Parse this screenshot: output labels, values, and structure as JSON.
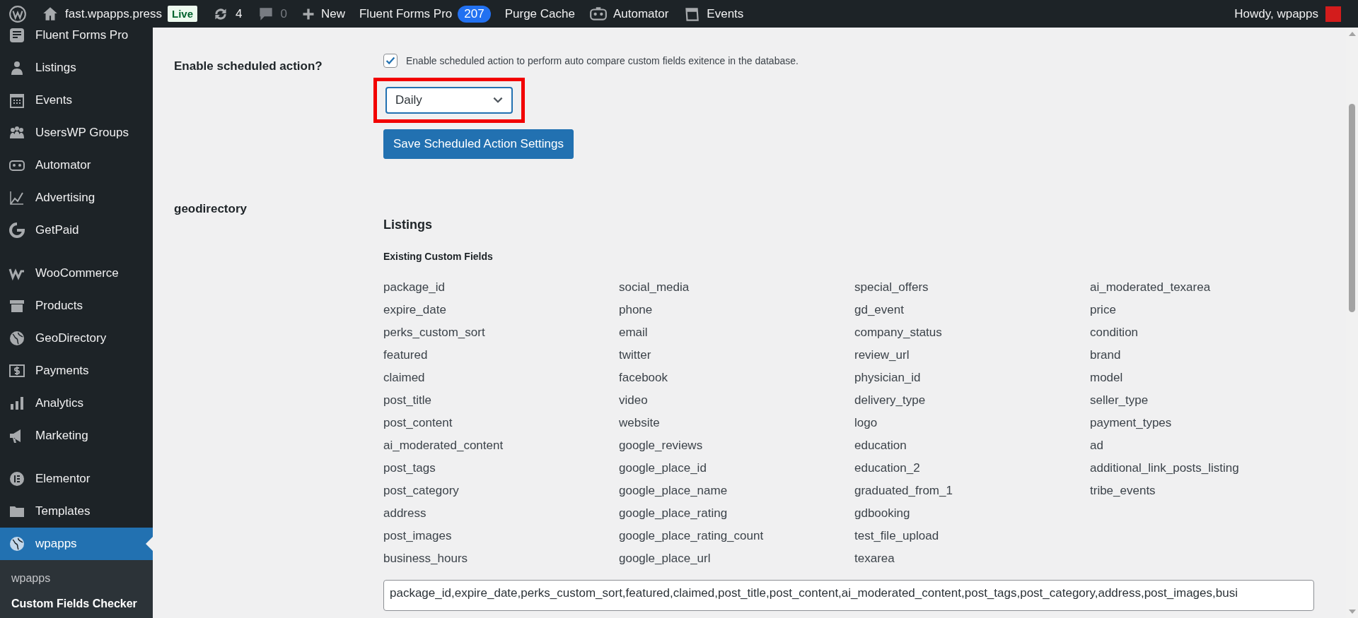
{
  "admin_bar": {
    "site_name": "fast.wpapps.press",
    "live_badge": "Live",
    "updates_count": "4",
    "comments_count": "0",
    "new_label": "New",
    "fluent_forms": {
      "label": "Fluent Forms Pro",
      "count": "207"
    },
    "purge_cache": "Purge Cache",
    "automator": "Automator",
    "events": "Events",
    "greeting": "Howdy, wpapps"
  },
  "sidebar": {
    "groups": [
      [
        {
          "label": "Fluent Forms Pro",
          "selected": false
        },
        {
          "label": "Listings",
          "selected": false
        },
        {
          "label": "Events",
          "selected": false
        },
        {
          "label": "UsersWP Groups",
          "selected": false
        },
        {
          "label": "Automator",
          "selected": false
        },
        {
          "label": "Advertising",
          "selected": false
        },
        {
          "label": "GetPaid",
          "selected": false
        }
      ],
      [
        {
          "label": "WooCommerce",
          "selected": false
        },
        {
          "label": "Products",
          "selected": false
        },
        {
          "label": "GeoDirectory",
          "selected": false
        },
        {
          "label": "Payments",
          "selected": false
        },
        {
          "label": "Analytics",
          "selected": false
        },
        {
          "label": "Marketing",
          "selected": false
        }
      ],
      [
        {
          "label": "Elementor",
          "selected": false
        },
        {
          "label": "Templates",
          "selected": false
        },
        {
          "label": "wpapps",
          "selected": true
        }
      ]
    ],
    "submenu": [
      {
        "label": "wpapps",
        "selected": false
      },
      {
        "label": "Custom Fields Checker",
        "selected": true
      }
    ]
  },
  "scheduled": {
    "label": "Enable scheduled action?",
    "checkbox": {
      "checked": true,
      "label": "Enable scheduled action to perform auto compare custom fields exitence in the database."
    },
    "frequency": {
      "value": "Daily",
      "highlighted": true
    },
    "save_button": "Save Scheduled Action Settings"
  },
  "section": {
    "name": "geodirectory",
    "post_type": "Listings",
    "subheading": "Existing Custom Fields",
    "columns": [
      [
        "package_id",
        "expire_date",
        "perks_custom_sort",
        "featured",
        "claimed",
        "post_title",
        "post_content",
        "ai_moderated_content",
        "post_tags",
        "post_category",
        "address",
        "post_images",
        "business_hours"
      ],
      [
        "social_media",
        "phone",
        "email",
        "twitter",
        "facebook",
        "video",
        "website",
        "google_reviews",
        "google_place_id",
        "google_place_name",
        "google_place_rating",
        "google_place_rating_count",
        "google_place_url"
      ],
      [
        "special_offers",
        "gd_event",
        "company_status",
        "review_url",
        "physician_id",
        "delivery_type",
        "logo",
        "education",
        "education_2",
        "graduated_from_1",
        "gdbooking",
        "test_file_upload",
        "texarea"
      ],
      [
        "ai_moderated_texarea",
        "price",
        "condition",
        "brand",
        "model",
        "seller_type",
        "payment_types",
        "ad",
        "additional_link_posts_listing",
        "tribe_events"
      ]
    ],
    "fields_text": "package_id,expire_date,perks_custom_sort,featured,claimed,post_title,post_content,ai_moderated_content,post_tags,post_category,address,post_images,busi"
  }
}
